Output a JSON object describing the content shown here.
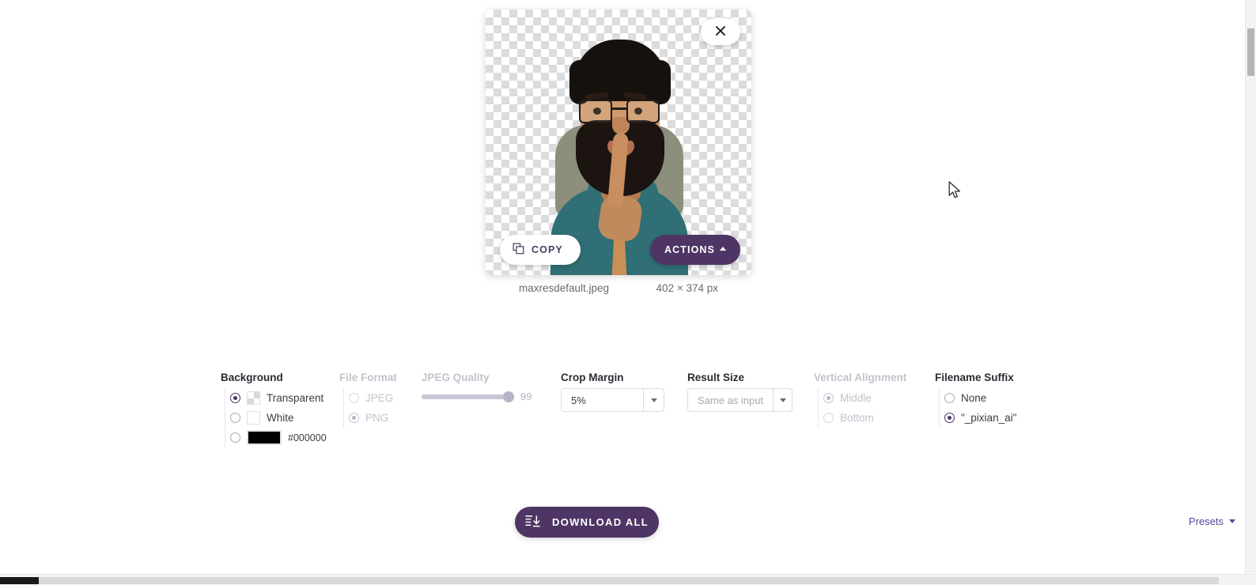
{
  "image_card": {
    "close_icon": "close-icon",
    "copy_button": {
      "label": "COPY",
      "icon": "copy-icon"
    },
    "actions_button": {
      "label": "ACTIONS",
      "icon": "caret-up-icon"
    },
    "filename": "maxresdefault.jpeg",
    "dimensions": "402 × 374 px",
    "background_type": "transparent-checkerboard",
    "photo_alt": "portrait of bearded man with glasses making shush gesture"
  },
  "settings": {
    "background": {
      "title": "Background",
      "options": [
        {
          "label": "Transparent",
          "swatch": "transparent",
          "checked": true
        },
        {
          "label": "White",
          "swatch": "white",
          "checked": false
        },
        {
          "label": "#000000",
          "swatch": "color",
          "color": "#000000",
          "checked": false
        }
      ]
    },
    "file_format": {
      "title": "File Format",
      "disabled": true,
      "options": [
        {
          "label": "JPEG",
          "checked": false
        },
        {
          "label": "PNG",
          "checked": true
        }
      ]
    },
    "jpeg_quality": {
      "title": "JPEG Quality",
      "disabled": true,
      "value": "99",
      "percent": 99
    },
    "crop_margin": {
      "title": "Crop Margin",
      "value": "5%"
    },
    "result_size": {
      "title": "Result Size",
      "value": "Same as input",
      "is_placeholder": true
    },
    "vertical_alignment": {
      "title": "Vertical Alignment",
      "disabled": true,
      "options": [
        {
          "label": "Middle",
          "checked": true
        },
        {
          "label": "Bottom",
          "checked": false
        }
      ]
    },
    "filename_suffix": {
      "title": "Filename Suffix",
      "options": [
        {
          "label": "None",
          "checked": false
        },
        {
          "label": "\"_pixian_ai\"",
          "checked": true
        }
      ]
    }
  },
  "footer": {
    "download_all": {
      "label": "DOWNLOAD ALL",
      "icon": "download-list-icon"
    },
    "presets": {
      "label": "Presets",
      "icon": "caret-down-icon"
    }
  },
  "theme": {
    "accent": "#4e3565",
    "link": "#54489c",
    "muted": "#c3c2cc"
  }
}
